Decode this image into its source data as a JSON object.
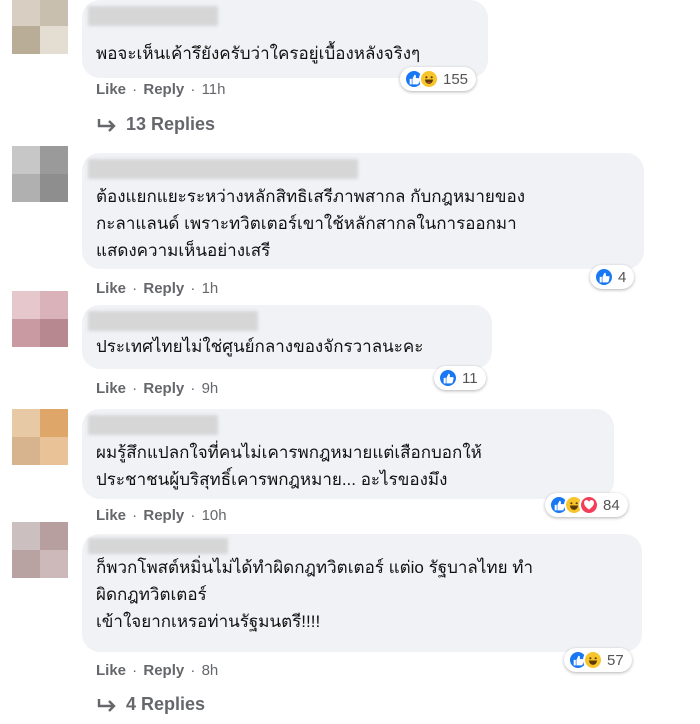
{
  "comments": [
    {
      "text": "พอจะเห็นเค้ารึยังครับว่าใครอยู่เบื้องหลังจริงๆ",
      "reactions": [
        "like",
        "haha"
      ],
      "reaction_count": "155",
      "like_label": "Like",
      "reply_label": "Reply",
      "time": "11h",
      "replies_label": "13 Replies"
    },
    {
      "text": "ต้องแยกแยะระหว่างหลักสิทธิเสรีภาพสากล กับกฎหมายของ\nกะลาแลนด์ เพราะทวิตเตอร์เขาใช้หลักสากลในการออกมา\nแสดงความเห็นอย่างเสรี",
      "reactions": [
        "like"
      ],
      "reaction_count": "4",
      "like_label": "Like",
      "reply_label": "Reply",
      "time": "1h"
    },
    {
      "text": "ประเทศไทยไม่ใช่ศูนย์กลางของจักรวาลนะคะ",
      "reactions": [
        "like"
      ],
      "reaction_count": "11",
      "like_label": "Like",
      "reply_label": "Reply",
      "time": "9h"
    },
    {
      "text": "ผมรู้สึกแปลกใจที่คนไม่เคารพกฎหมายแต่เสือกบอกให้\nประชาชนผู้บริสุทธิ์เคารพกฎหมาย... อะไรของมึง",
      "reactions": [
        "like",
        "haha",
        "love"
      ],
      "reaction_count": "84",
      "like_label": "Like",
      "reply_label": "Reply",
      "time": "10h"
    },
    {
      "text": "ก็พวกโพสต์หมิ่นไม่ได้ทำผิดกฎทวิตเตอร์ แต่io รัฐบาลไทย ทำ\nผิดกฎทวิตเตอร์\nเข้าใจยากเหรอท่านรัฐมนตรี!!!!",
      "reactions": [
        "like",
        "haha"
      ],
      "reaction_count": "57",
      "like_label": "Like",
      "reply_label": "Reply",
      "time": "8h",
      "replies_label": "4 Replies"
    }
  ],
  "colors": {
    "bubble": "#f0f2f5",
    "like": "#1877f2",
    "haha": "#f7c52b",
    "love": "#f33e58",
    "meta": "#65676b"
  }
}
